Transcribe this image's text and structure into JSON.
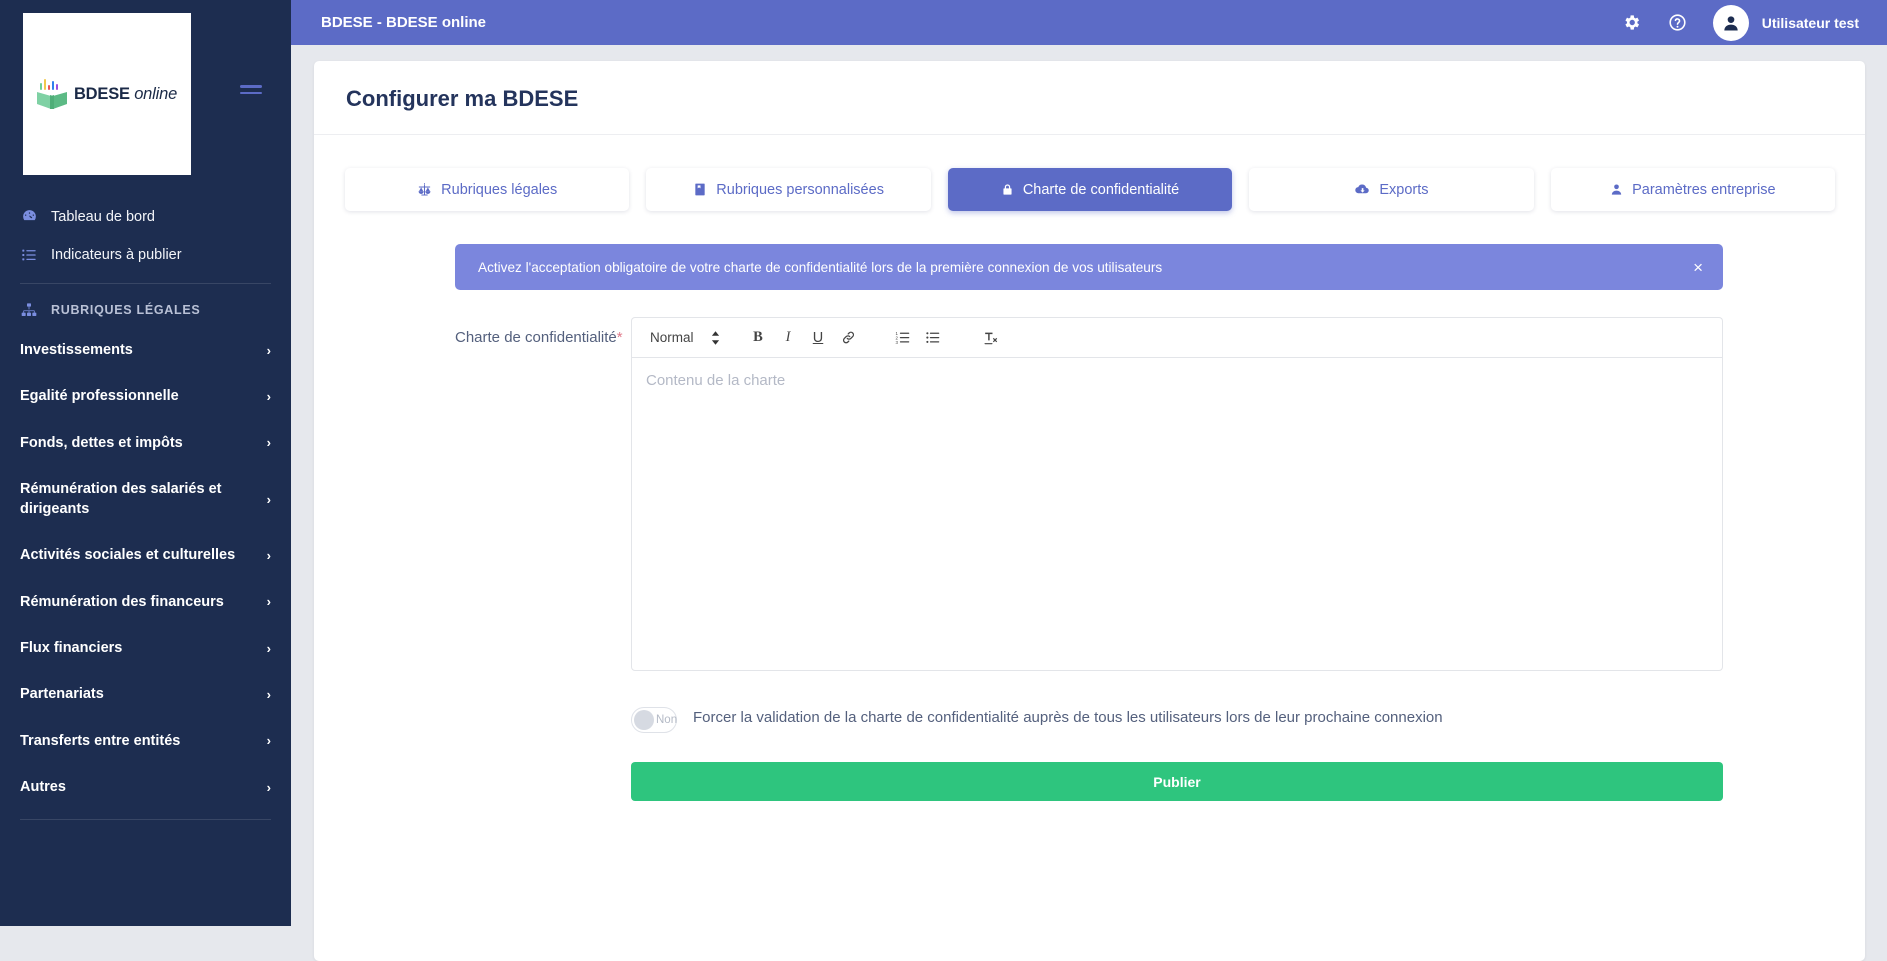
{
  "brand": {
    "logo_text": "BDESE",
    "logo_text_italic": "online",
    "logo_bar_colors": [
      "#6fcf97",
      "#f2c94c",
      "#eb5757",
      "#2f80ed",
      "#9b51e0"
    ],
    "logo_book_color": "#7fd1a4"
  },
  "topbar": {
    "title": "BDESE - BDESE online",
    "settings_icon": "gear-icon",
    "help_icon": "question-circle-icon",
    "avatar_icon": "user-icon",
    "username": "Utilisateur test",
    "background": "#5c6bc6"
  },
  "sidebar": {
    "hamburger_icon": "hamburger-icon",
    "top_items": [
      {
        "label": "Tableau de bord",
        "icon": "dashboard-icon"
      },
      {
        "label": "Indicateurs à publier",
        "icon": "list-icon"
      }
    ],
    "section_title": "RUBRIQUES LÉGALES",
    "section_icon": "sitemap-icon",
    "items": [
      {
        "label": "Investissements",
        "chevron": "›"
      },
      {
        "label": "Egalité professionnelle",
        "chevron": "›"
      },
      {
        "label": "Fonds, dettes et impôts",
        "chevron": "›"
      },
      {
        "label": "Rémunération des salariés et dirigeants",
        "chevron": "›"
      },
      {
        "label": "Activités sociales et culturelles",
        "chevron": "›"
      },
      {
        "label": "Rémunération des financeurs",
        "chevron": "›"
      },
      {
        "label": "Flux financiers",
        "chevron": "›"
      },
      {
        "label": "Partenariats",
        "chevron": "›"
      },
      {
        "label": "Transferts entre entités",
        "chevron": "›"
      },
      {
        "label": "Autres",
        "chevron": "›"
      }
    ],
    "background": "#1d2d50"
  },
  "page": {
    "title": "Configurer ma BDESE"
  },
  "tabs": [
    {
      "label": "Rubriques légales",
      "icon": "scales-icon",
      "active": false
    },
    {
      "label": "Rubriques personnalisées",
      "icon": "book-icon",
      "active": false
    },
    {
      "label": "Charte de confidentialité",
      "icon": "lock-icon",
      "active": true
    },
    {
      "label": "Exports",
      "icon": "cloud-download-icon",
      "active": false
    },
    {
      "label": "Paramètres entreprise",
      "icon": "user-icon",
      "active": false
    }
  ],
  "alert": {
    "message": "Activez l'acceptation obligatoire de votre charte de confidentialité lors de la première connexion de vos utilisateurs",
    "close_label": "×",
    "background": "#7b86dd"
  },
  "form": {
    "label": "Charte de confidentialité",
    "required_marker": "*",
    "editor": {
      "format_select_value": "Normal",
      "toolbar_buttons": [
        {
          "name": "bold-icon",
          "label": "B"
        },
        {
          "name": "italic-icon",
          "label": "I"
        },
        {
          "name": "underline-icon",
          "label": "U"
        },
        {
          "name": "link-icon",
          "label": "🔗"
        },
        {
          "name": "ordered-list-icon",
          "label": ""
        },
        {
          "name": "bullet-list-icon",
          "label": ""
        },
        {
          "name": "clear-format-icon",
          "label": ""
        }
      ],
      "placeholder": "Contenu de la charte",
      "value": ""
    },
    "toggle": {
      "state_label": "Non",
      "checked": false,
      "description": "Forcer la validation de la charte de confidentialité auprès de tous les utilisateurs lors de leur prochaine connexion"
    },
    "submit_label": "Publier",
    "submit_color": "#2ec57e"
  }
}
